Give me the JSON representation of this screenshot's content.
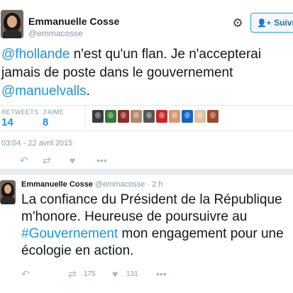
{
  "tweet1": {
    "author_name": "Emmanuelle Cosse",
    "author_handle": "@emmacosse",
    "follow_label": "Suivre",
    "text_parts": [
      {
        "type": "mention",
        "text": "@fhollande"
      },
      {
        "type": "text",
        "text": " n'est qu'un flan. Je n'accepterai jamais de poste dans le gouvernement "
      },
      {
        "type": "mention",
        "text": "@manuelvalls"
      },
      {
        "type": "text",
        "text": "."
      }
    ],
    "stats": {
      "retweets_label": "RETWEETS",
      "retweets_value": "14",
      "likes_label": "J'AIME",
      "likes_value": "8"
    },
    "liker_avatar_colors": [
      "#3c3c3c",
      "#2e7d32",
      "#8e2a2a",
      "#b5876b",
      "#555555",
      "#c62828",
      "#d79a73",
      "#1565c0",
      "#e0c0a0",
      "#9c4a2a"
    ],
    "timestamp": "03:04 - 22 avril 2015",
    "icons": {
      "settings": "gear-icon",
      "follow": "person-plus-icon",
      "reply": "reply-icon",
      "retweet": "retweet-icon",
      "like": "heart-icon",
      "more": "more-icon"
    }
  },
  "tweet2": {
    "author_name": "Emmanuelle Cosse",
    "author_handle": "@emmacosse",
    "time_ago": "· 2 h",
    "text_parts": [
      {
        "type": "text",
        "text": "La confiance du Président de la République m'honore. Heureuse de poursuivre au "
      },
      {
        "type": "hashtag",
        "text": "#Gouvernement"
      },
      {
        "type": "text",
        "text": " mon engagement pour une écologie en action."
      }
    ],
    "retweet_count": "175",
    "like_count": "131"
  },
  "colors": {
    "link": "#1b95e0",
    "muted": "#8899a6",
    "divider": "#e1e8ed",
    "band": "#e6ecf0"
  }
}
